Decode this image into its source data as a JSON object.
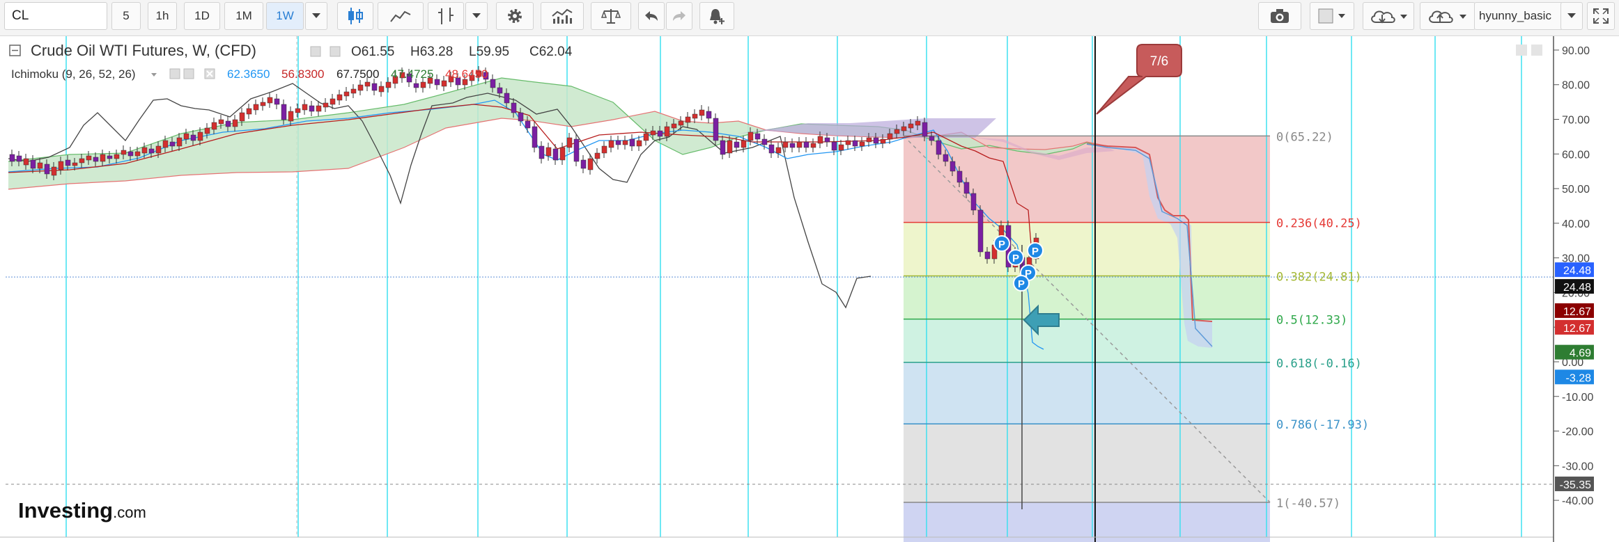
{
  "toolbar": {
    "symbol": "CL",
    "intervals": [
      "5",
      "1h",
      "1D",
      "1M",
      "1W"
    ],
    "active_interval": "1W",
    "username": "hyunny_basic"
  },
  "legend": {
    "title": "Crude Oil WTI Futures, W, (CFD)",
    "open": "O61.55",
    "high": "H63.28",
    "low": "L59.95",
    "close": "C62.04",
    "indicator": "Ichimoku (9, 26, 52, 26)",
    "ichimoku_values": [
      {
        "value": "62.3650",
        "color": "#2196f3"
      },
      {
        "value": "56.8300",
        "color": "#c62828"
      },
      {
        "value": "67.7500",
        "color": "#222222"
      },
      {
        "value": "47.4725",
        "color": "#2e7d32"
      },
      {
        "value": "48.6450",
        "color": "#e53935"
      }
    ]
  },
  "annotation": {
    "label": "7/6"
  },
  "logo": {
    "brand": "Investing",
    "suffix": ".com"
  },
  "price_axis": {
    "ticks": [
      "90.00",
      "80.00",
      "70.00",
      "60.00",
      "50.00",
      "40.00",
      "30.00",
      "20.00",
      "10.00",
      "0.00",
      "-10.00",
      "-20.00",
      "-30.00",
      "-40.00"
    ],
    "min": -45,
    "max": 92,
    "badges": [
      {
        "value": "24.48",
        "price": 24.48,
        "bg": "#2962ff",
        "fg": "#ffffff"
      },
      {
        "value": "24.48",
        "price": 24.48,
        "bg": "#111111",
        "fg": "#ffffff"
      },
      {
        "value": "12.67",
        "price": 12.67,
        "bg": "#8b0000",
        "fg": "#ffffff"
      },
      {
        "value": "12.67",
        "price": 12.67,
        "bg": "#d32f2f",
        "fg": "#ffffff"
      },
      {
        "value": "4.69",
        "price": 4.69,
        "bg": "#2e7d32",
        "fg": "#ffffff"
      },
      {
        "value": "-3.28",
        "price": -3.28,
        "bg": "#1e88e5",
        "fg": "#ffffff"
      },
      {
        "value": "-35.35",
        "price": -35.35,
        "bg": "#555555",
        "fg": "#ffffff"
      }
    ]
  },
  "fib_levels": [
    {
      "label": "0(65.22)",
      "price": 65.22,
      "color": "#888888",
      "fill": "#f2c8c8"
    },
    {
      "label": "0.236(40.25)",
      "price": 40.25,
      "color": "#e53935",
      "fill": "#eef5cc"
    },
    {
      "label": "0.382(24.81)",
      "price": 24.81,
      "color": "#a4b834",
      "fill": "#d5f3cf"
    },
    {
      "label": "0.5(12.33)",
      "price": 12.33,
      "color": "#2ea84a",
      "fill": "#cff2e2"
    },
    {
      "label": "0.618(-0.16)",
      "price": -0.16,
      "color": "#2aa08a",
      "fill": "#cfe3f2"
    },
    {
      "label": "0.786(-17.93)",
      "price": -17.93,
      "color": "#3a92c8",
      "fill": "#e2e2e2"
    },
    {
      "label": "1(-40.57)",
      "price": -40.57,
      "color": "#888888",
      "fill": "#cfd4f2"
    }
  ],
  "markers": {
    "label": "P",
    "color": "#1e88e5"
  },
  "colors": {
    "up": "#d32f2f",
    "down": "#7b1fa2",
    "tenkan": "#2196f3",
    "kijun": "#b71c1c",
    "chikou": "#444444",
    "kumo_bull": "#c8e6c9",
    "kumo_bear": "#f8c7c7",
    "gridline_cyan": "#3fe0f0"
  }
}
